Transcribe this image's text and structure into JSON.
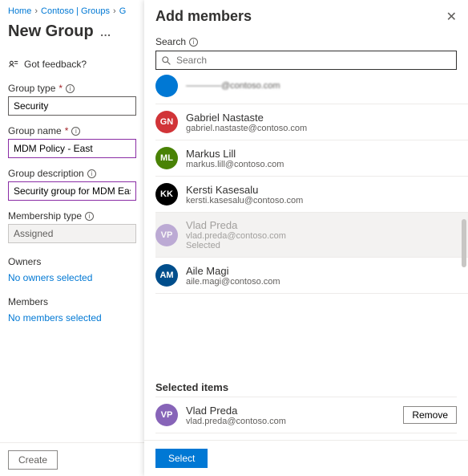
{
  "breadcrumb": {
    "home": "Home",
    "contoso": "Contoso | Groups",
    "extra": "G"
  },
  "page_title": "New Group",
  "feedback_label": "Got feedback?",
  "fields": {
    "group_type": {
      "label": "Group type",
      "value": "Security"
    },
    "group_name": {
      "label": "Group name",
      "value": "MDM Policy - East"
    },
    "group_desc": {
      "label": "Group description",
      "value": "Security group for MDM East"
    },
    "membership": {
      "label": "Membership type",
      "value": "Assigned"
    }
  },
  "owners": {
    "label": "Owners",
    "empty": "No owners selected"
  },
  "members": {
    "label": "Members",
    "empty": "No members selected"
  },
  "create_label": "Create",
  "flyout": {
    "title": "Add members",
    "search_label": "Search",
    "search_placeholder": "Search",
    "results": [
      {
        "initials": "GN",
        "name": "Gabriel Nastaste",
        "email": "gabriel.nastaste@contoso.com",
        "color": "#d13438"
      },
      {
        "initials": "ML",
        "name": "Markus Lill",
        "email": "markus.lill@contoso.com",
        "color": "#498205"
      },
      {
        "initials": "KK",
        "name": "Kersti Kasesalu",
        "email": "kersti.kasesalu@contoso.com",
        "color": "#000000"
      },
      {
        "initials": "VP",
        "name": "Vlad Preda",
        "email": "vlad.preda@contoso.com",
        "color": "#8764b8",
        "selected": true
      },
      {
        "initials": "AM",
        "name": "Aile Magi",
        "email": "aile.magi@contoso.com",
        "color": "#004e8c"
      }
    ],
    "selected_heading": "Selected items",
    "selected": {
      "initials": "VP",
      "name": "Vlad Preda",
      "email": "vlad.preda@contoso.com",
      "color": "#8764b8"
    },
    "remove_label": "Remove",
    "select_label": "Select",
    "selected_tag": "Selected"
  }
}
